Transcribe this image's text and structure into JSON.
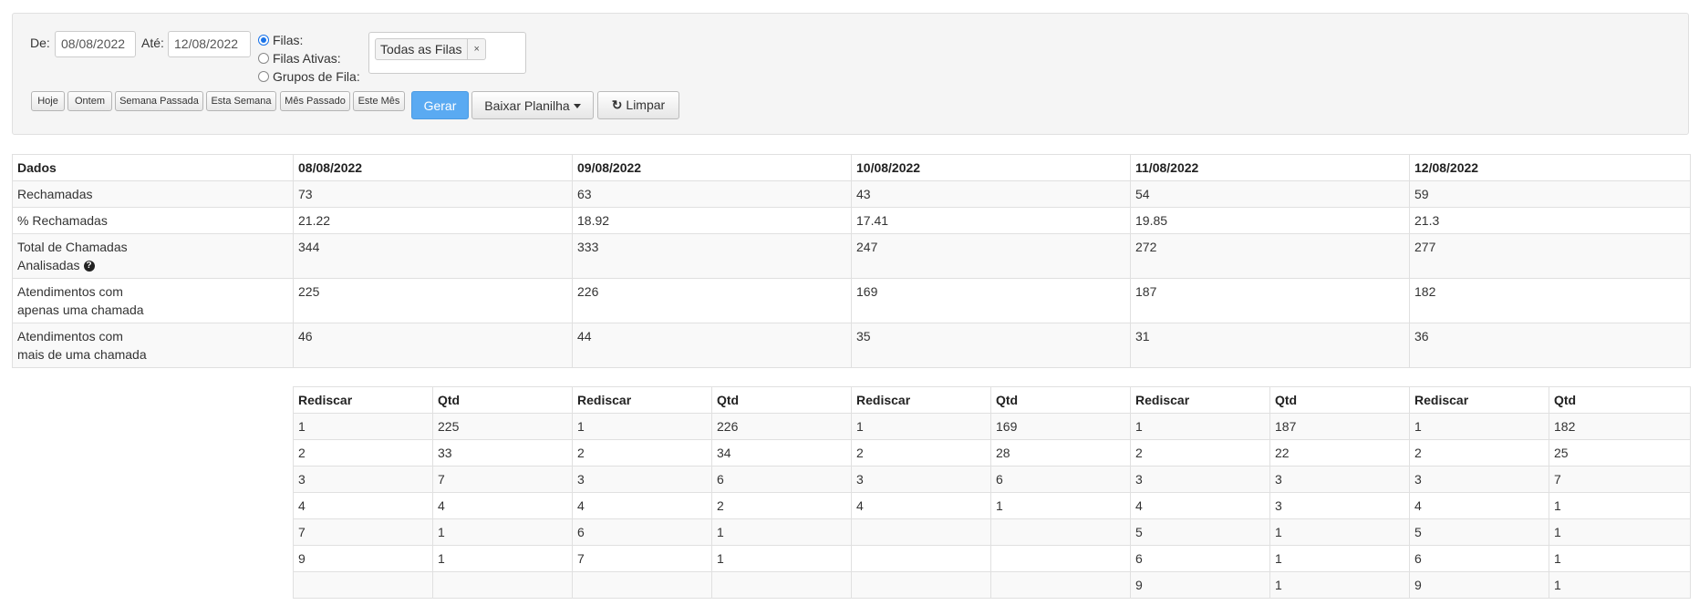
{
  "filters": {
    "from_label": "De:",
    "from_value": "08/08/2022",
    "to_label": "Até:",
    "to_value": "12/08/2022",
    "radios": [
      {
        "label": "Filas:",
        "checked": true
      },
      {
        "label": "Filas Ativas:",
        "checked": false
      },
      {
        "label": "Grupos de Fila:",
        "checked": false
      }
    ],
    "selected_tag": "Todas as Filas",
    "tag_remove": "×"
  },
  "quick_buttons": [
    "Hoje",
    "Ontem",
    "Semana Passada",
    "Esta Semana",
    "Mês Passado",
    "Este Mês"
  ],
  "actions": {
    "generate": "Gerar",
    "download": "Baixar Planilha",
    "clear": "Limpar"
  },
  "summary": {
    "header": [
      "Dados",
      "08/08/2022",
      "09/08/2022",
      "10/08/2022",
      "11/08/2022",
      "12/08/2022"
    ],
    "rows": [
      {
        "label": "Rechamadas",
        "values": [
          "73",
          "63",
          "43",
          "54",
          "59"
        ]
      },
      {
        "label": "% Rechamadas",
        "values": [
          "21.22",
          "18.92",
          "17.41",
          "19.85",
          "21.3"
        ]
      },
      {
        "label": "Total de Chamadas\nAnalisadas",
        "values": [
          "344",
          "333",
          "247",
          "272",
          "277"
        ],
        "help": true
      },
      {
        "label": "Atendimentos com\napenas uma chamada",
        "values": [
          "225",
          "226",
          "169",
          "187",
          "182"
        ]
      },
      {
        "label": "Atendimentos com\nmais de uma chamada",
        "values": [
          "46",
          "44",
          "35",
          "31",
          "36"
        ]
      }
    ]
  },
  "detail": {
    "header": [
      "Rediscar",
      "Qtd",
      "Rediscar",
      "Qtd",
      "Rediscar",
      "Qtd",
      "Rediscar",
      "Qtd",
      "Rediscar",
      "Qtd"
    ],
    "rows": [
      [
        "1",
        "225",
        "1",
        "226",
        "1",
        "169",
        "1",
        "187",
        "1",
        "182"
      ],
      [
        "2",
        "33",
        "2",
        "34",
        "2",
        "28",
        "2",
        "22",
        "2",
        "25"
      ],
      [
        "3",
        "7",
        "3",
        "6",
        "3",
        "6",
        "3",
        "3",
        "3",
        "7"
      ],
      [
        "4",
        "4",
        "4",
        "2",
        "4",
        "1",
        "4",
        "3",
        "4",
        "1"
      ],
      [
        "7",
        "1",
        "6",
        "1",
        "",
        "",
        "5",
        "1",
        "5",
        "1"
      ],
      [
        "9",
        "1",
        "7",
        "1",
        "",
        "",
        "6",
        "1",
        "6",
        "1"
      ],
      [
        "",
        "",
        "",
        "",
        "",
        "",
        "9",
        "1",
        "9",
        "1"
      ]
    ]
  }
}
